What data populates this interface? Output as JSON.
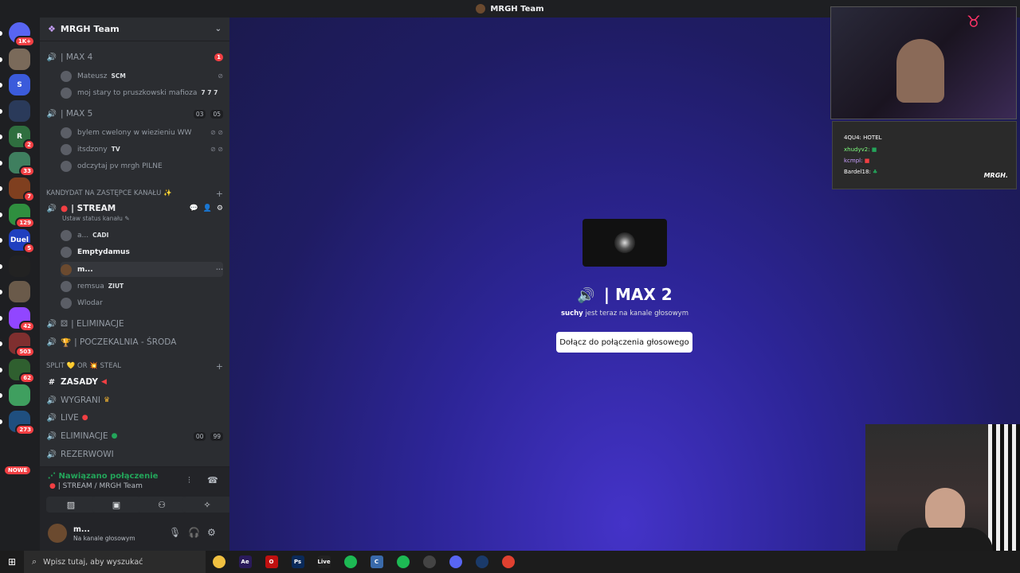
{
  "window": {
    "title": "MRGH Team"
  },
  "rail": {
    "servers": [
      {
        "label": "",
        "badge": "1K+",
        "color": "#5865f2"
      },
      {
        "label": "",
        "badge": "",
        "color": "#7a6a5a"
      },
      {
        "label": "S",
        "badge": "",
        "color": "#3b5bdb"
      },
      {
        "label": "",
        "badge": "",
        "color": "#2a3a5a"
      },
      {
        "label": "R",
        "badge": "2",
        "color": "#2f6f3f"
      },
      {
        "label": "",
        "badge": "33",
        "color": "#3f7f5f"
      },
      {
        "label": "",
        "badge": "7",
        "color": "#7f3f1f"
      },
      {
        "label": "",
        "badge": "129",
        "color": "#2f8f3f"
      },
      {
        "label": "Duel",
        "badge": "5",
        "color": "#1f3fbf"
      },
      {
        "label": "",
        "badge": "",
        "color": "#222222"
      },
      {
        "label": "",
        "badge": "",
        "color": "#6a5a4a"
      },
      {
        "label": "",
        "badge": "42",
        "color": "#9146ff"
      },
      {
        "label": "",
        "badge": "503",
        "color": "#7f2f2f"
      },
      {
        "label": "",
        "badge": "62",
        "color": "#2f5f2f"
      },
      {
        "label": "",
        "badge": "",
        "color": "#3f9f5f"
      },
      {
        "label": "",
        "badge": "273",
        "color": "#1f4f7f"
      }
    ],
    "new_label": "NOWE"
  },
  "sidebar": {
    "guild_name": "MRGH Team",
    "channels": {
      "max4": {
        "name": "| MAX 4",
        "badge": "1"
      },
      "max4_users": [
        {
          "name": "Mateusz",
          "tag": "SCM"
        },
        {
          "name": "moj stary to pruszkowski mafioza",
          "tag": "7 7 7"
        }
      ],
      "max5": {
        "name": "| MAX 5",
        "cnt1": "03",
        "cnt2": "05"
      },
      "max5_users": [
        {
          "name": "bylem cwelony w wiezieniu WW",
          "tag": ""
        },
        {
          "name": "itsdzony",
          "tag": "TV"
        },
        {
          "name": "odczytaj pv mrgh PILNE",
          "tag": ""
        }
      ],
      "category1": "KANDYDAT NA ZASTĘPCE KANAŁU ✨",
      "stream": {
        "name": "| STREAM",
        "status": "Ustaw status kanału"
      },
      "stream_users": [
        {
          "name": "a...",
          "tag": "CADI"
        },
        {
          "name": "Emptydamus",
          "tag": ""
        },
        {
          "name": "m...",
          "tag": ""
        },
        {
          "name": "remsua",
          "tag": "ZIUT"
        },
        {
          "name": "Wlodar",
          "tag": ""
        }
      ],
      "eliminacje": "| ELIMINACJE",
      "poczekalnia": "| POCZEKALNIA - ŚRODA",
      "category2": "SPLIT 💛 OR 💥 STEAL",
      "zasady": "ZASADY",
      "wygrani": "WYGRANI",
      "live": "LIVE",
      "eliminacje2": {
        "name": "ELIMINACJE",
        "cnt1": "00",
        "cnt2": "99"
      },
      "rezerwowi": "REZERWOWI"
    }
  },
  "voice": {
    "connected": "Nawiązano połączenie",
    "location": "| STREAM / MRGH Team"
  },
  "user": {
    "name": "m...",
    "status": "Na kanale głosowym"
  },
  "stage": {
    "channel_title": "| MAX 2",
    "presence_user": "suchy",
    "presence_text": "jest teraz na kanale głosowym",
    "join_label": "Dołącz do połączenia głosowego"
  },
  "overlay": {
    "chat": [
      {
        "name": "4QU4:",
        "text": "HOTEL"
      },
      {
        "name": "xhudyv2:",
        "text": ""
      },
      {
        "name": "kcmpl:",
        "text": ""
      },
      {
        "name": "Bardel18:",
        "text": ""
      }
    ],
    "brand": "MRGH."
  },
  "taskbar": {
    "search_placeholder": "Wpisz tutaj, aby wyszukać",
    "apps": [
      {
        "label": "",
        "color": "#f0c040"
      },
      {
        "label": "Ae",
        "color": "#2a1a5a"
      },
      {
        "label": "O",
        "color": "#c01010"
      },
      {
        "label": "Ps",
        "color": "#0a2a5a"
      },
      {
        "label": "Live",
        "color": "#222222"
      },
      {
        "label": "",
        "color": "#1db954"
      },
      {
        "label": "C",
        "color": "#3a6aaa"
      },
      {
        "label": "",
        "color": "#1db954"
      },
      {
        "label": "",
        "color": "#444444"
      },
      {
        "label": "",
        "color": "#5865f2"
      },
      {
        "label": "",
        "color": "#1a3a6a"
      },
      {
        "label": "",
        "color": "#e04030"
      }
    ]
  }
}
